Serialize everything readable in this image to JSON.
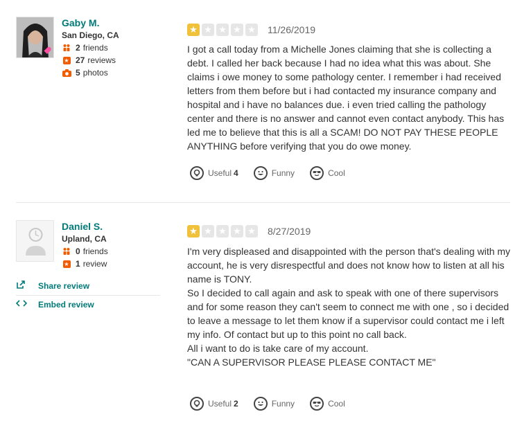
{
  "reviews": [
    {
      "user": {
        "name": "Gaby M.",
        "location": "San Diego, CA",
        "friends_count": "2",
        "friends_label": "friends",
        "reviews_count": "27",
        "reviews_label": "reviews",
        "photos_count": "5",
        "photos_label": "photos"
      },
      "rating": 1,
      "rating_max": 5,
      "date": "11/26/2019",
      "text_lines": [
        "I got a call today from a Michelle Jones claiming that she is collecting a debt. I called her back because I had no idea what this was about. She claims i owe money to some pathology center. I remember i had received letters from them before but i had contacted my insurance company and hospital and i have no balances due. i even tried calling the pathology center and there is no answer and cannot even contact anybody. This has led me to believe that this is all a SCAM! DO NOT PAY THESE PEOPLE ANYTHING before verifying that you do owe money."
      ],
      "votes": {
        "useful_label": "Useful",
        "useful_count": "4",
        "funny_label": "Funny",
        "cool_label": "Cool"
      }
    },
    {
      "user": {
        "name": "Daniel S.",
        "location": "Upland, CA",
        "friends_count": "0",
        "friends_label": "friends",
        "reviews_count": "1",
        "reviews_label": "review"
      },
      "rating": 1,
      "rating_max": 5,
      "date": "8/27/2019",
      "text_lines": [
        "I'm very displeased and disappointed with the person that's dealing with my account, he is very disrespectful and does not know how to listen at all his name is TONY.",
        "So I decided to call again and ask to speak with one of there supervisors and for some reason they can't seem to connect me with one , so i decided to leave a message to let them know if a supervisor could contact me i left my info. Of contact but up to this point no call back.",
        "All i want to do is take care of my account.",
        "\"CAN A SUPERVISOR PLEASE PLEASE CONTACT ME\""
      ],
      "votes": {
        "useful_label": "Useful",
        "useful_count": "2",
        "funny_label": "Funny",
        "cool_label": "Cool"
      },
      "actions": {
        "share_label": "Share review",
        "embed_label": "Embed review"
      }
    }
  ],
  "colors": {
    "link": "#027a7a",
    "star_on": "#f0c23c",
    "star_off": "#e6e6e6",
    "stat_icon": "#f15c00"
  },
  "icons": {
    "friends": "friends-icon",
    "reviews": "review-star-icon",
    "photos": "camera-icon",
    "useful": "lightbulb-icon",
    "funny": "smile-icon",
    "cool": "sunglasses-icon",
    "share": "share-icon",
    "embed": "embed-code-icon"
  }
}
